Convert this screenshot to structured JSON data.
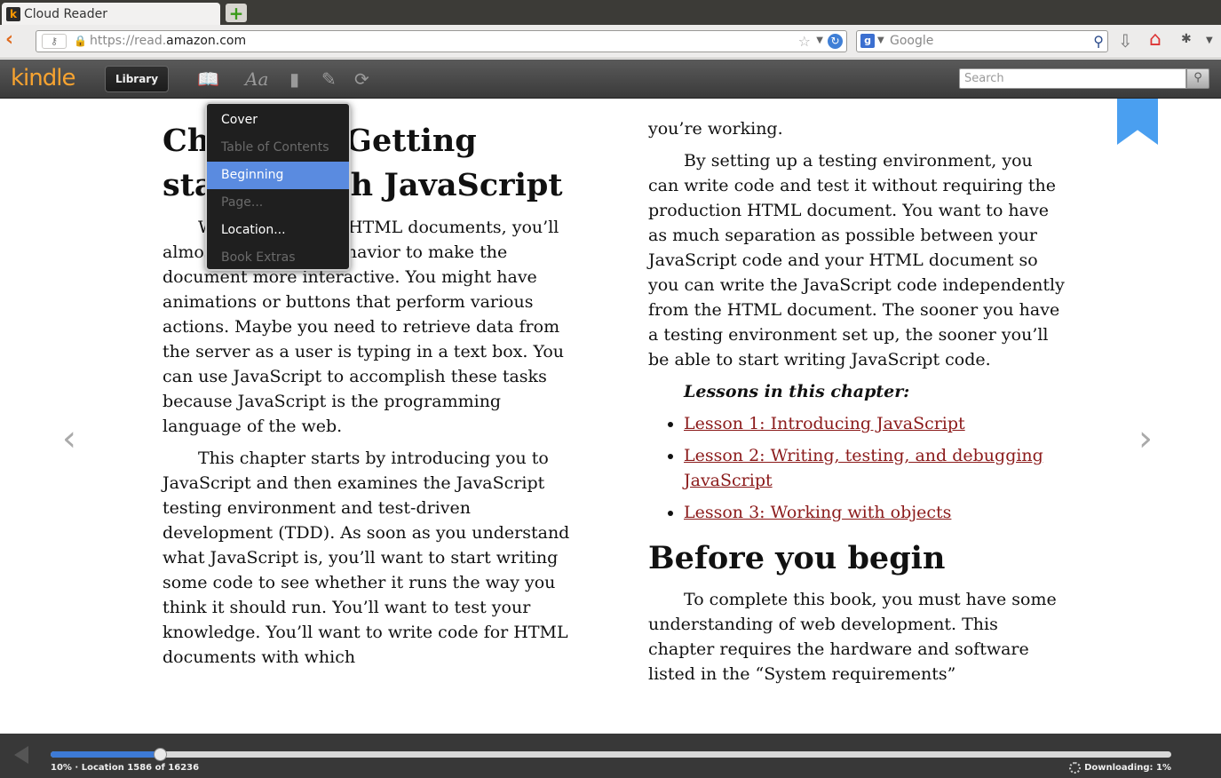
{
  "browser": {
    "tab_title": "Cloud Reader",
    "url_prefix": "https://read.",
    "url_domain": "amazon.com",
    "search_engine_letter": "g",
    "search_placeholder": "Google"
  },
  "kindle": {
    "logo": "kindle",
    "library_label": "Library",
    "search_placeholder": "Search"
  },
  "goto_menu": {
    "items": [
      {
        "label": "Cover",
        "state": "enabled"
      },
      {
        "label": "Table of Contents",
        "state": "disabled"
      },
      {
        "label": "Beginning",
        "state": "active"
      },
      {
        "label": "Page...",
        "state": "disabled"
      },
      {
        "label": "Location...",
        "state": "enabled"
      },
      {
        "label": "Book Extras",
        "state": "disabled"
      }
    ]
  },
  "book": {
    "chapter_title": "Chapter 1 Getting started with JavaScript",
    "left_paragraphs": [
      "When you create HTML documents, you’ll almost always add behavior to make the document more interactive. You might have animations or buttons that perform various actions. Maybe you need to retrieve data from the server as a user is typing in a text box. You can use JavaScript to accomplish these tasks because JavaScript is the programming language of the web.",
      "This chapter starts by introducing you to JavaScript and then examines the JavaScript testing environment and test-driven development (TDD). As soon as you understand what JavaScript is, you’ll want to start writing some code to see whether it runs the way you think it should run. You’ll want to test your knowledge. You’ll want to write code for HTML documents with which"
    ],
    "right_continuation": "you’re working.",
    "right_paragraph": "By setting up a testing environment, you can write code and test it without requiring the production HTML document. You want to have as much separation as possible between your JavaScript code and your HTML document so you can write the JavaScript code independently from the HTML document. The sooner you have a testing environment set up, the sooner you’ll be able to start writing JavaScript code.",
    "lessons_heading": "Lessons in this chapter:",
    "lessons": [
      "Lesson 1: Introducing JavaScript",
      "Lesson 2: Writing, testing, and debugging JavaScript",
      "Lesson 3: Working with objects"
    ],
    "section_title": "Before you begin",
    "section_paragraph": "To complete this book, you must have some understanding of web development. This chapter requires the hardware and software listed in the “System requirements”"
  },
  "progress": {
    "fraction": 0.0977,
    "location_text": "10% · Location 1586 of 16236",
    "download_text": "Downloading: 1%"
  },
  "colors": {
    "kindle_orange": "#f7a330",
    "accent_blue": "#3d7ad6",
    "link_red": "#8b1a1a"
  }
}
